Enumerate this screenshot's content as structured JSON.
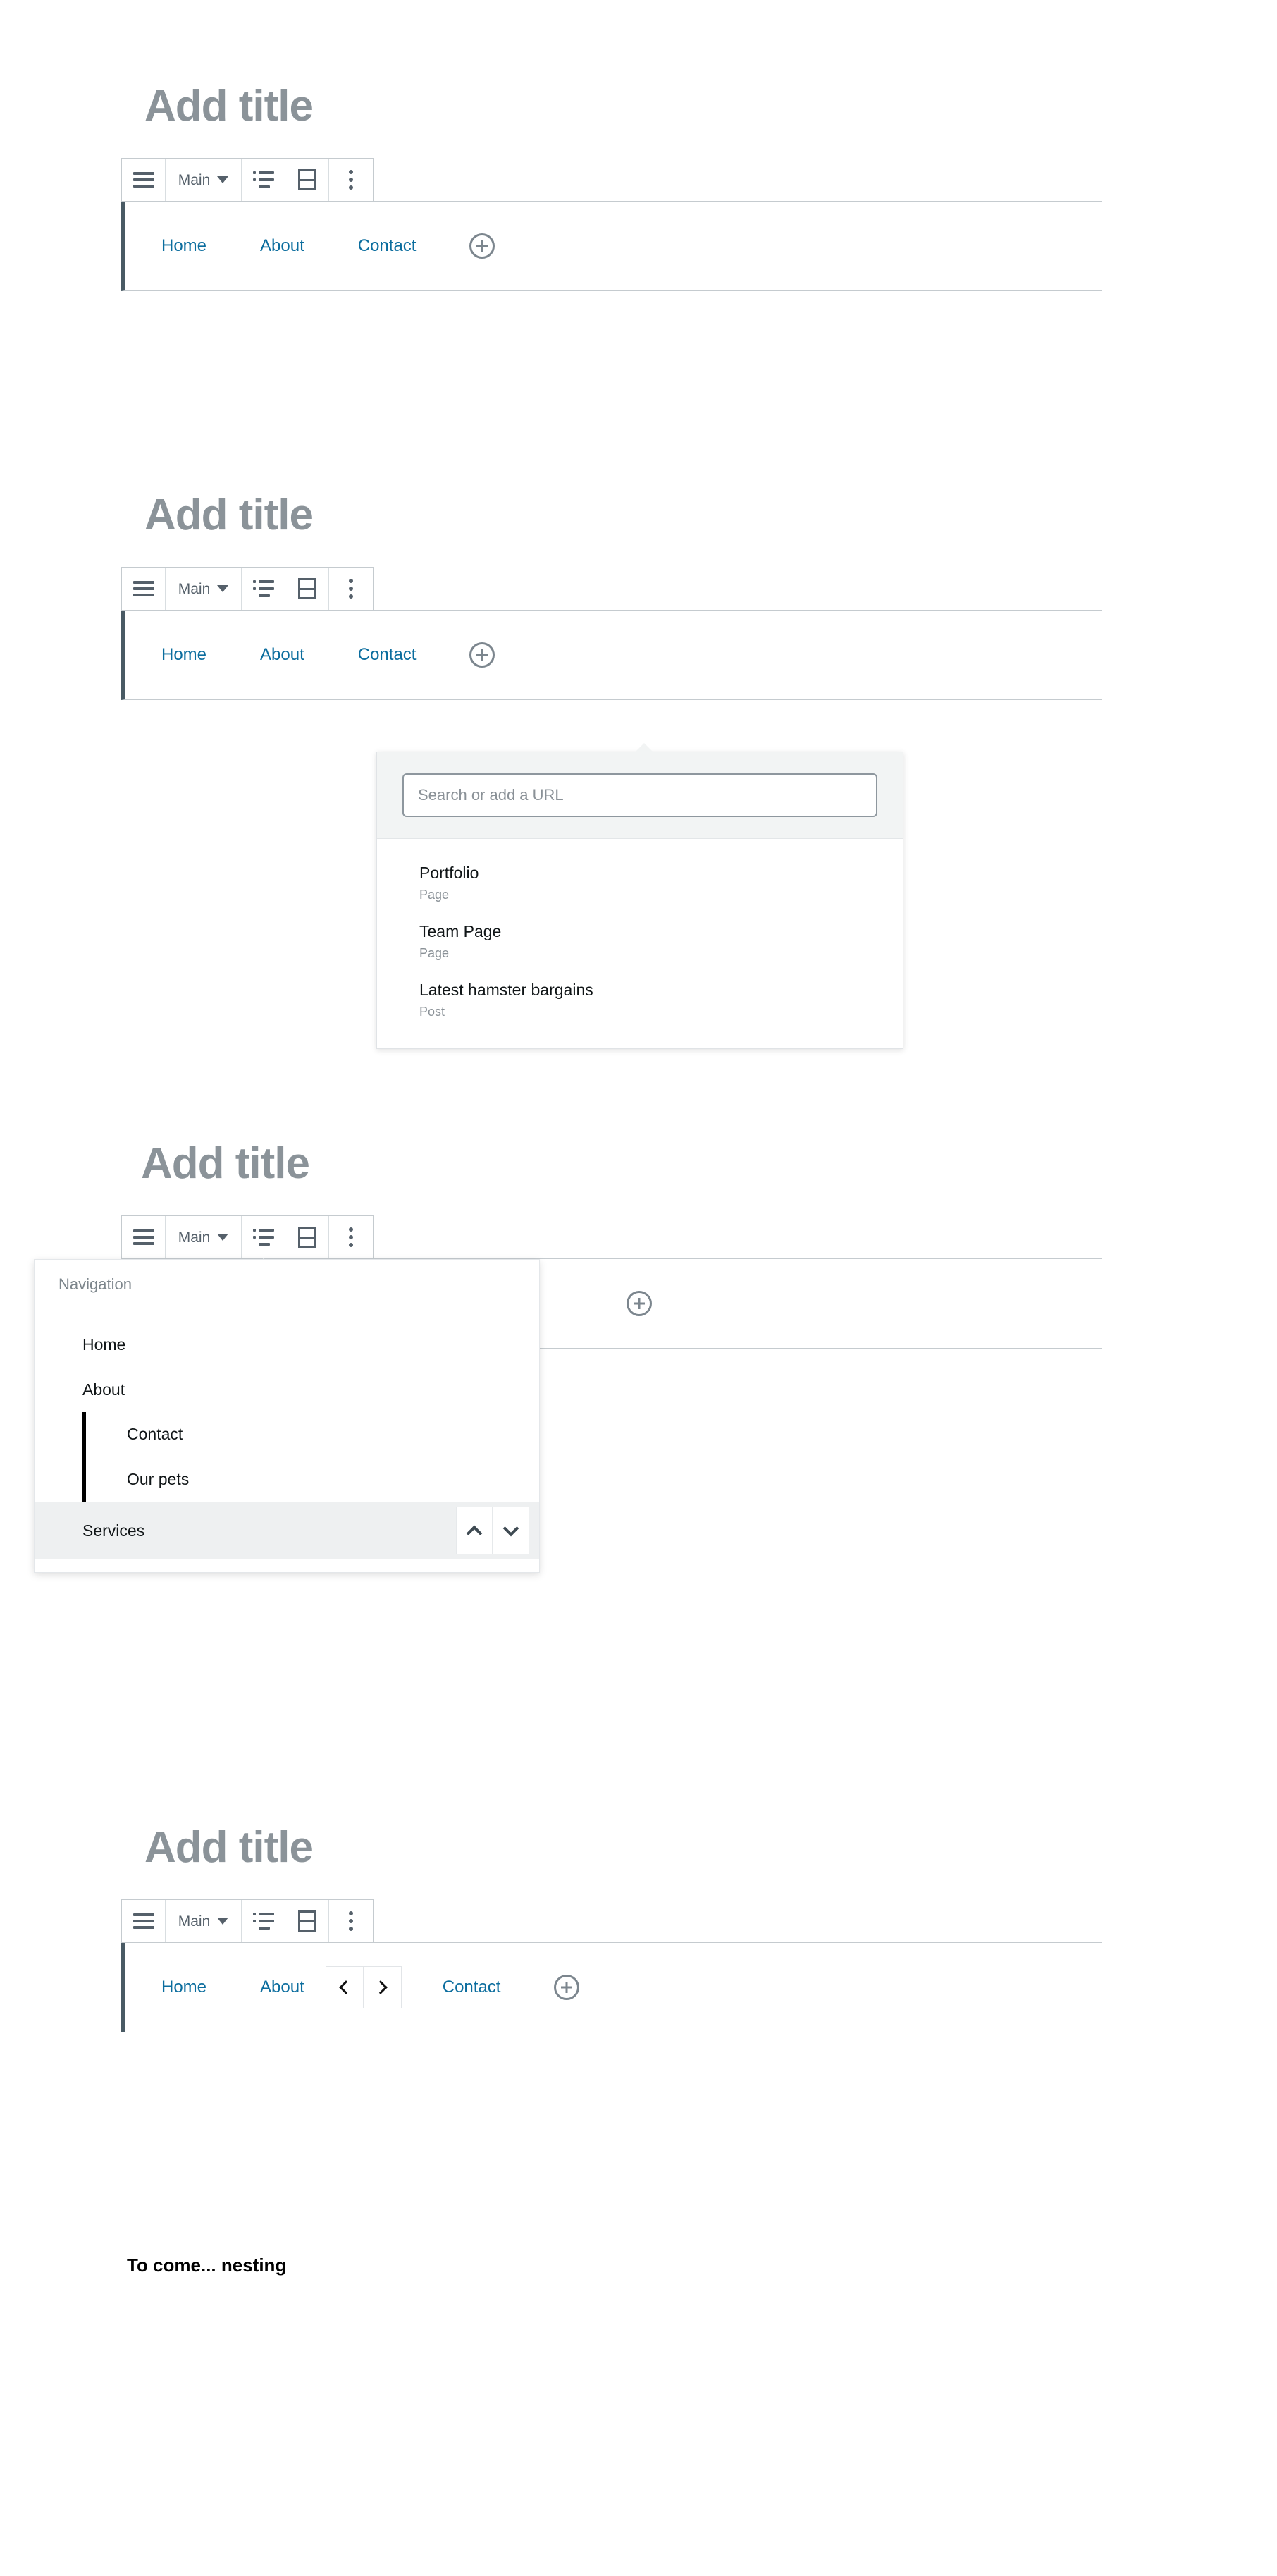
{
  "colors": {
    "link": "#0b6d9e",
    "title_gray": "#8b9399",
    "toolbar_icon": "#55606a",
    "block_selected_border": "#495a64",
    "selected_row_bg": "#eef0f1",
    "search_head_bg": "#f2f4f4"
  },
  "toolbar": {
    "drag_handle_icon": "hamburger-icon",
    "block_type_label": "Main",
    "block_type_caret_icon": "chevron-down-icon",
    "list_view_icon": "list-view-icon",
    "block_layout_icon": "block-layout-icon",
    "more_options_icon": "kebab-menu-icon"
  },
  "sections": [
    {
      "id": "section-default",
      "title": "Add title",
      "nav_links": [
        "Home",
        "About",
        "Contact"
      ],
      "appender_icon": "circle-plus-icon"
    },
    {
      "id": "section-link-search",
      "title": "Add title",
      "nav_links": [
        "Home",
        "About",
        "Contact"
      ],
      "appender_icon": "circle-plus-icon",
      "link_popover": {
        "search_placeholder": "Search or add a URL",
        "search_value": "",
        "suggestions": [
          {
            "title": "Portfolio",
            "type": "Page"
          },
          {
            "title": "Team Page",
            "type": "Page"
          },
          {
            "title": "Latest hamster bargains",
            "type": "Post"
          }
        ]
      }
    },
    {
      "id": "section-list-view",
      "title": "Add title",
      "nav_links": [],
      "appender_icon": "circle-plus-icon",
      "list_view": {
        "header": "Navigation",
        "items": [
          {
            "label": "Home",
            "depth": 0,
            "selected": false
          },
          {
            "label": "About",
            "depth": 0,
            "selected": false
          },
          {
            "label": "Contact",
            "depth": 1,
            "selected": false
          },
          {
            "label": "Our pets",
            "depth": 1,
            "selected": false
          },
          {
            "label": "Services",
            "depth": 0,
            "selected": true
          }
        ],
        "move_up_icon": "chevron-up-icon",
        "move_down_icon": "chevron-down-icon"
      }
    },
    {
      "id": "section-reorder",
      "title": "Add title",
      "nav_links_before": [
        "Home",
        "About"
      ],
      "nav_links_after": [
        "Contact"
      ],
      "move_left_icon": "chevron-left-icon",
      "move_right_icon": "chevron-right-icon",
      "appender_icon": "circle-plus-icon"
    }
  ],
  "footer_note": "To come... nesting"
}
